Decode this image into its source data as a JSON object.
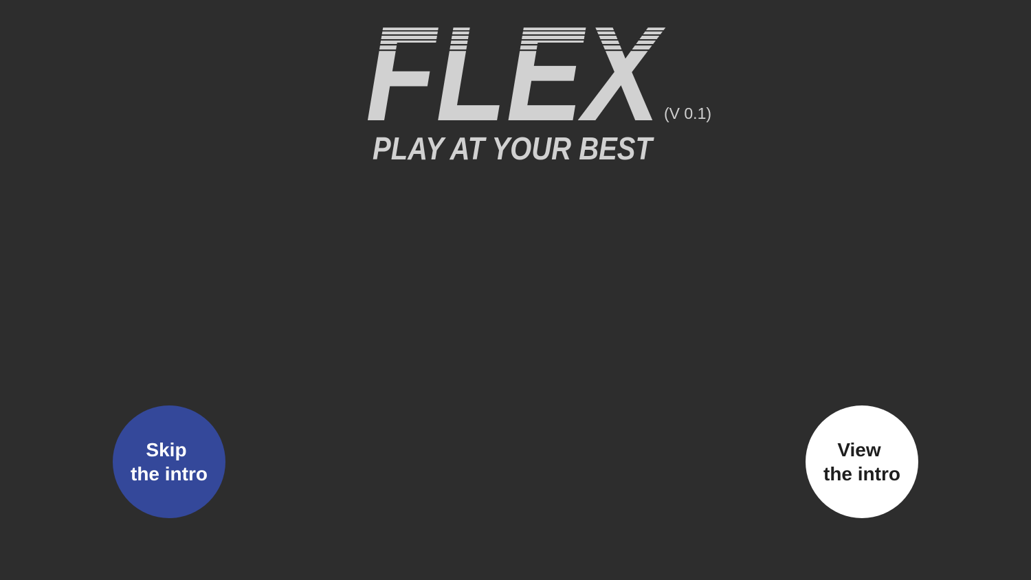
{
  "branding": {
    "logo_text": "FLEX",
    "tagline": "PLAY AT YOUR BEST",
    "version": "(V 0.1)"
  },
  "intro_actions": {
    "skip": {
      "line1": "Skip",
      "line2": "the intro"
    },
    "view": {
      "line1": "View",
      "line2": "the intro"
    }
  },
  "colors": {
    "background": "#2d2d2d",
    "logo": "#d1d1d1",
    "skip_button": "#34489a",
    "view_button": "#ffffff"
  }
}
